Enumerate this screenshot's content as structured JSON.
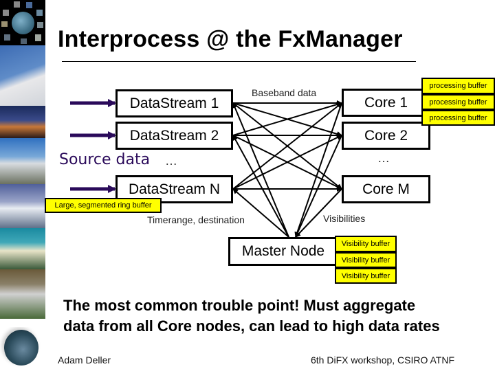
{
  "title": "Interprocess @ the FxManager",
  "diagram": {
    "source_label": "Source data",
    "datastreams": [
      "DataStream 1",
      "DataStream 2",
      "DataStream N"
    ],
    "datastream_ellipsis": "…",
    "cores": [
      "Core 1",
      "Core 2",
      "Core M"
    ],
    "core_ellipsis": "…",
    "master": "Master Node",
    "edge_labels": {
      "baseband": "Baseband data",
      "timerange": "Timerange, destination",
      "visibilities": "Visibilities"
    },
    "ring_buffer_note": "Large, segmented ring buffer",
    "processing_buffers": [
      "processing buffer",
      "processing buffer",
      "processing buffer"
    ],
    "visibility_buffers": [
      "Visibility buffer",
      "Visibility buffer",
      "Visibility buffer"
    ],
    "colors": {
      "arrow": "#2a0a5a",
      "buffer": "#ffff00"
    }
  },
  "body_text": {
    "line1": "The most common trouble point! Must aggregate",
    "line2": "data from all Core nodes, can lead to high data rates"
  },
  "footer": {
    "author": "Adam Deller",
    "event": "6th DiFX workshop, CSIRO ATNF"
  },
  "decor": {
    "strip_images": [
      "world-map-collage",
      "radio-telescope",
      "telescope-dusk",
      "telescope-trees",
      "telescope-cloudy",
      "telescope-teal",
      "telescope-aerial",
      "globe"
    ]
  }
}
